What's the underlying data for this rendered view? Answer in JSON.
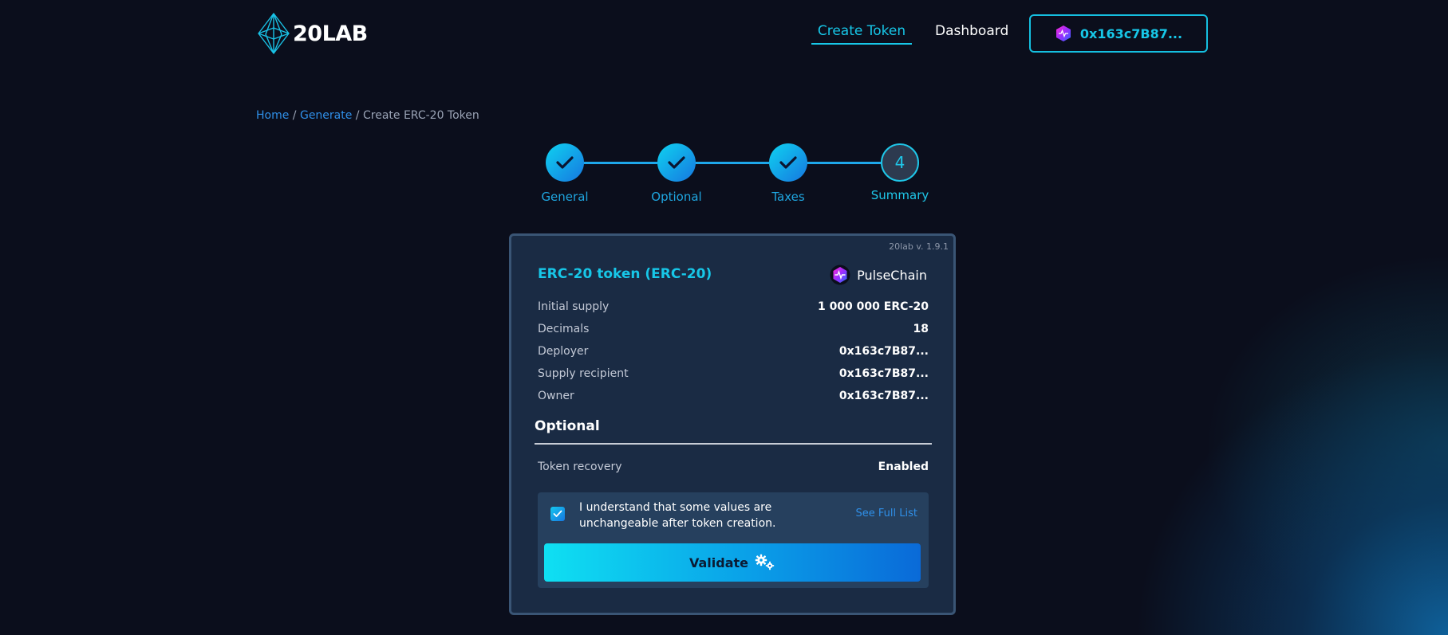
{
  "header": {
    "logo_text": "20LAB",
    "nav": {
      "create": "Create Token",
      "dashboard": "Dashboard"
    },
    "wallet_address": "0x163c7B87..."
  },
  "breadcrumb": {
    "home": "Home",
    "sep1": " / ",
    "generate": "Generate",
    "sep2": " / ",
    "current": "Create ERC-20 Token"
  },
  "stepper": {
    "steps": [
      {
        "label": "General",
        "status": "done"
      },
      {
        "label": "Optional",
        "status": "done"
      },
      {
        "label": "Taxes",
        "status": "done"
      },
      {
        "label": "Summary",
        "status": "current",
        "number": "4"
      }
    ]
  },
  "summary": {
    "version": "20lab v. 1.9.1",
    "token_title": "ERC-20 token (ERC-20)",
    "chain": "PulseChain",
    "rows": [
      {
        "key": "Initial supply",
        "value": "1 000 000 ERC-20"
      },
      {
        "key": "Decimals",
        "value": "18"
      },
      {
        "key": "Deployer",
        "value": "0x163c7B87..."
      },
      {
        "key": "Supply recipient",
        "value": "0x163c7B87..."
      },
      {
        "key": "Owner",
        "value": "0x163c7B87..."
      }
    ],
    "optional_title": "Optional",
    "optional_rows": [
      {
        "key": "Token recovery",
        "value": "Enabled"
      }
    ],
    "confirm_text": "I understand that some values are unchangeable after token creation.",
    "confirm_checked": true,
    "full_list_link": "See Full List",
    "validate_label": "Validate"
  },
  "colors": {
    "accent": "#17c7e8",
    "link": "#2f8fe8",
    "background": "#0b0e1c",
    "card": "#1a2b44"
  },
  "icons": [
    "logo-diamond-icon",
    "wallet-avatar-icon",
    "check-icon",
    "pulsechain-icon",
    "gears-icon"
  ]
}
